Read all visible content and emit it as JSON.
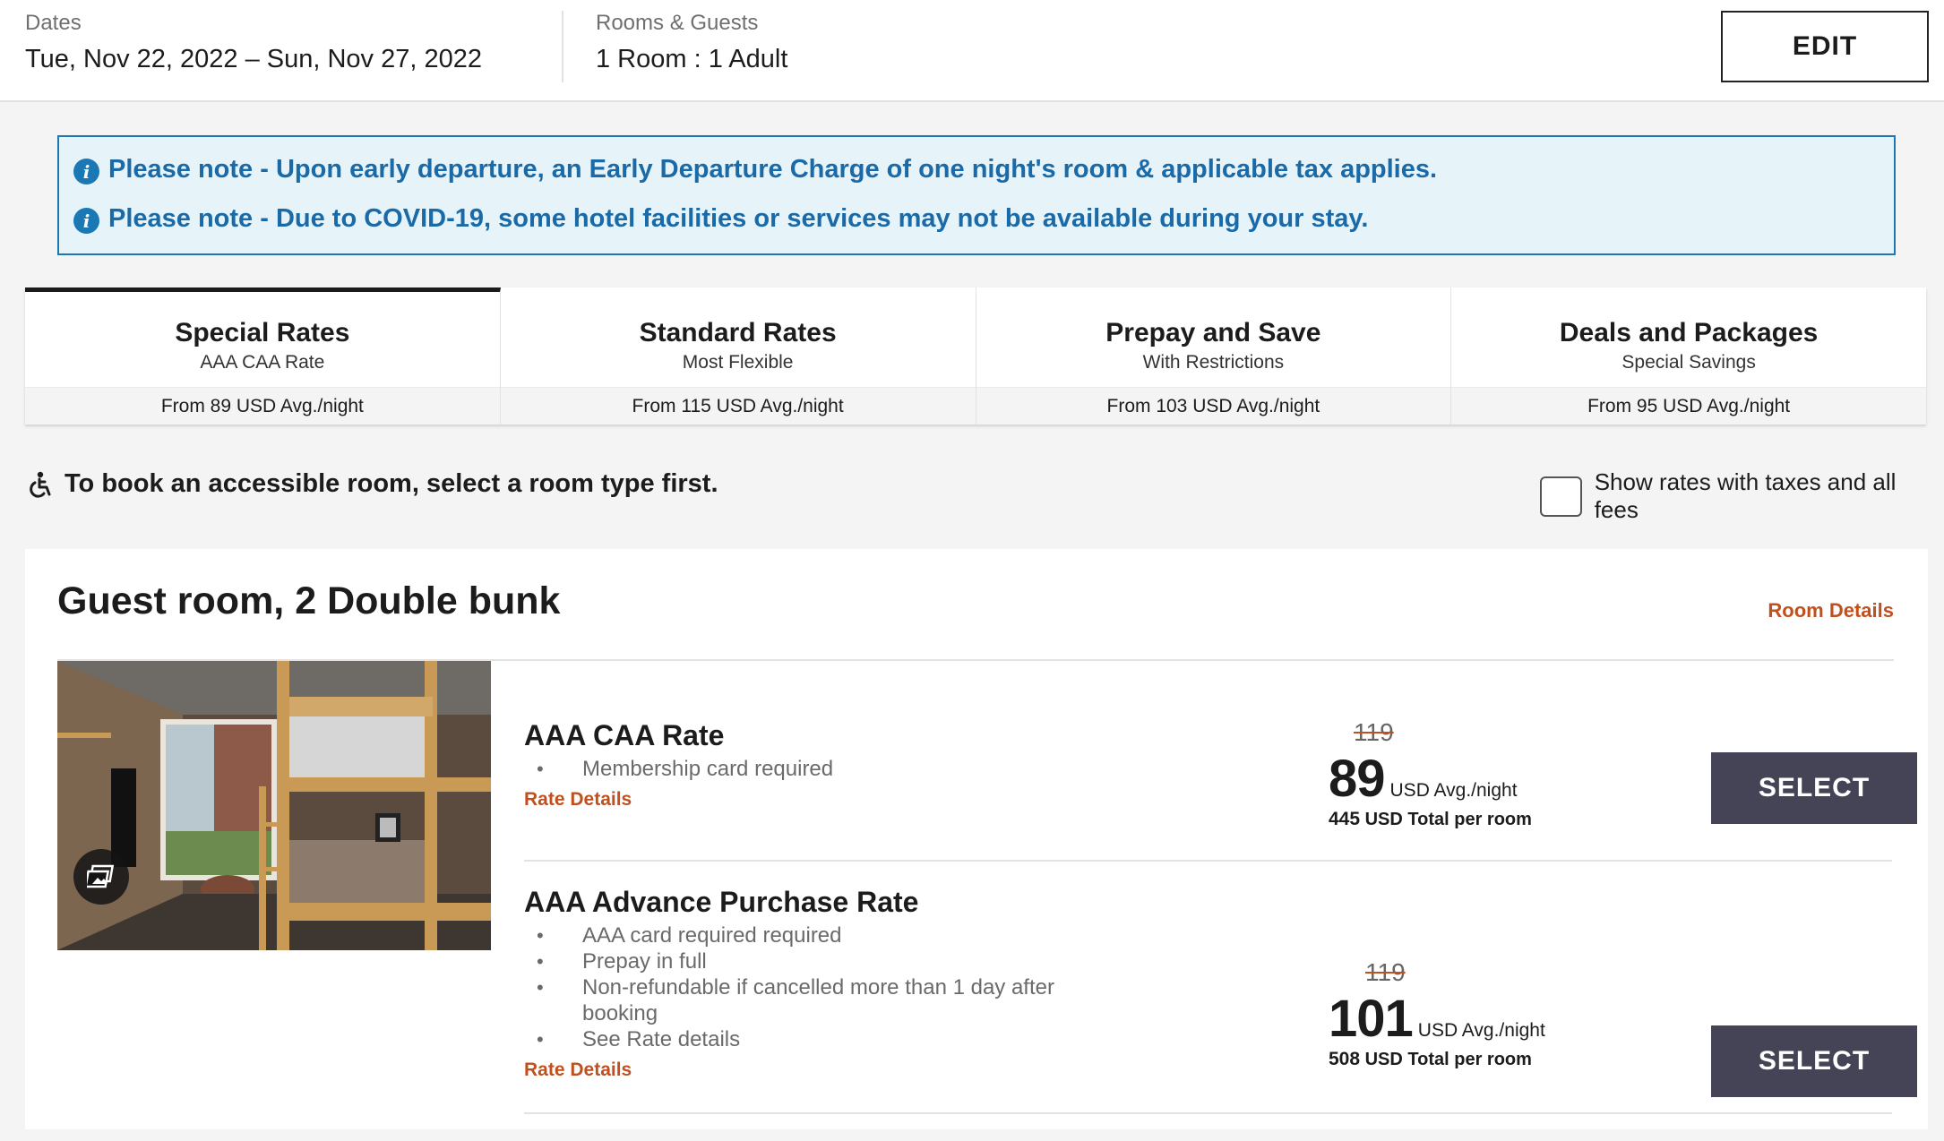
{
  "search_summary": {
    "dates_label": "Dates",
    "dates_value": "Tue, Nov 22, 2022 – Sun, Nov 27, 2022",
    "guests_label": "Rooms & Guests",
    "guests_value": "1 Room : 1 Adult",
    "edit_label": "EDIT"
  },
  "notices": [
    "Please note - Upon early departure, an Early Departure Charge of one night's room & applicable tax applies.",
    "Please note - Due to COVID-19, some hotel facilities or services may not be available during your stay."
  ],
  "rate_tabs": [
    {
      "name": "Special Rates",
      "sub": "AAA CAA Rate",
      "price": "From 89 USD Avg./night",
      "active": true
    },
    {
      "name": "Standard Rates",
      "sub": "Most Flexible",
      "price": "From 115 USD Avg./night",
      "active": false
    },
    {
      "name": "Prepay and Save",
      "sub": "With Restrictions",
      "price": "From 103 USD Avg./night",
      "active": false
    },
    {
      "name": "Deals and Packages",
      "sub": "Special Savings",
      "price": "From 95 USD Avg./night",
      "active": false
    }
  ],
  "accessibility_note": "To book an accessible room, select a room type first.",
  "tax_toggle_label": "Show rates with taxes and all fees",
  "room": {
    "title": "Guest room, 2 Double bunk",
    "details_link": "Room Details",
    "rates": [
      {
        "name": "AAA CAA Rate",
        "bullets": [
          "Membership card required"
        ],
        "details_link": "Rate Details",
        "old_price": "119",
        "price": "89",
        "price_unit": "USD Avg./night",
        "total_num": "445",
        "total_text": "USD Total per room",
        "select_label": "SELECT"
      },
      {
        "name": "AAA Advance Purchase Rate",
        "bullets": [
          "AAA card required required",
          "Prepay in full",
          "Non-refundable if cancelled more than 1 day after booking",
          "See Rate details"
        ],
        "details_link": "Rate Details",
        "old_price": "119",
        "price": "101",
        "price_unit": "USD Avg./night",
        "total_num": "508",
        "total_text": "USD Total per room",
        "select_label": "SELECT"
      }
    ]
  },
  "colors": {
    "accent_orange": "#c0501e",
    "notice_blue": "#1a78b5",
    "select_button": "#454356"
  }
}
